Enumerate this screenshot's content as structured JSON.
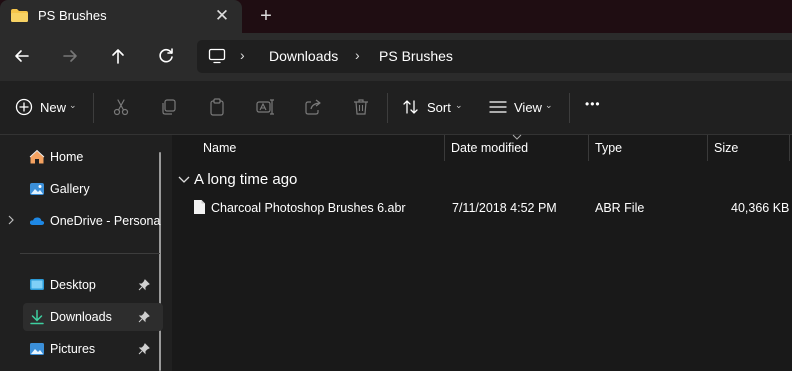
{
  "window": {
    "tab_title": "PS Brushes",
    "tab_close": "✕",
    "new_tab": "+"
  },
  "breadcrumb": {
    "items": [
      "Downloads",
      "PS Brushes"
    ],
    "separator": "›"
  },
  "toolbar": {
    "new_label": "New",
    "sort_label": "Sort",
    "view_label": "View",
    "more_label": "•••",
    "dropdown_glyph": "⌄"
  },
  "sidebar": {
    "items": [
      {
        "label": "Home",
        "icon": "home-icon"
      },
      {
        "label": "Gallery",
        "icon": "gallery-icon"
      },
      {
        "label": "OneDrive - Persona",
        "icon": "onedrive-icon"
      },
      {
        "label": "Desktop",
        "icon": "desktop-icon",
        "pinned": true
      },
      {
        "label": "Downloads",
        "icon": "download-icon",
        "pinned": true,
        "selected": true
      },
      {
        "label": "Pictures",
        "icon": "pictures-icon",
        "pinned": true
      }
    ]
  },
  "columns": {
    "name": "Name",
    "date": "Date modified",
    "type": "Type",
    "size": "Size"
  },
  "group": {
    "title": "A long time ago"
  },
  "files": [
    {
      "name": "Charcoal Photoshop Brushes 6.abr",
      "date": "7/11/2018 4:52 PM",
      "type": "ABR File",
      "size": "40,366 KB"
    }
  ],
  "colors": {
    "accent": "#4cc2ff",
    "folder": "#f4c44a",
    "titlebar": "#1f0d12"
  }
}
